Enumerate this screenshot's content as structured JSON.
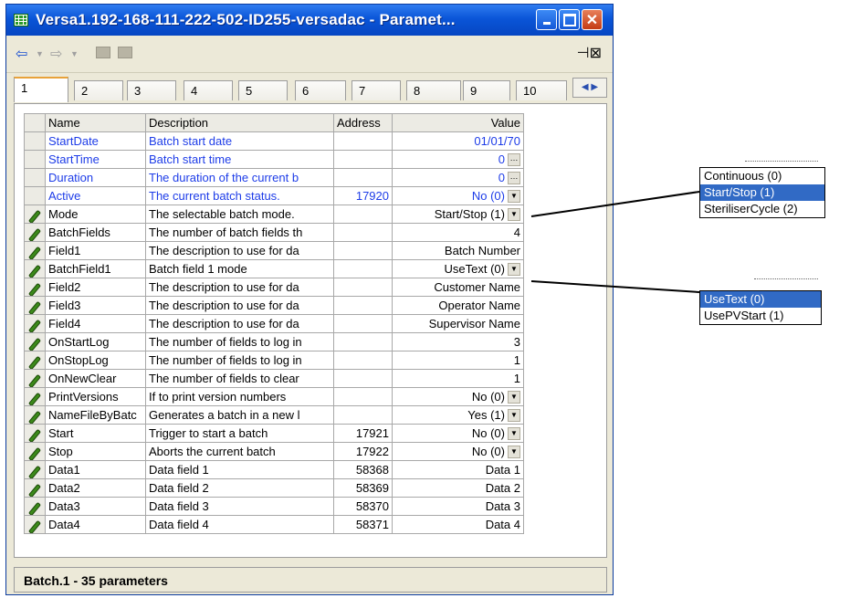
{
  "window": {
    "title": "Versa1.192-168-111-222-502-ID255-versadac - Paramet..."
  },
  "tabs": [
    "1",
    "2",
    "3",
    "4",
    "5",
    "6",
    "7",
    "8",
    "9",
    "10"
  ],
  "table": {
    "headers": {
      "name": "Name",
      "description": "Description",
      "address": "Address",
      "value": "Value"
    },
    "rows": [
      {
        "name": "StartDate",
        "description": "Batch start date",
        "address": "",
        "value": "01/01/70",
        "control": "none",
        "editable": false
      },
      {
        "name": "StartTime",
        "description": "Batch start time",
        "address": "",
        "value": "0",
        "control": "ellipsis",
        "editable": false
      },
      {
        "name": "Duration",
        "description": "The duration of the current b",
        "address": "",
        "value": "0",
        "control": "ellipsis",
        "editable": false
      },
      {
        "name": "Active",
        "description": "The current batch status.",
        "address": "17920",
        "value": "No (0)",
        "control": "dropdown",
        "editable": false
      },
      {
        "name": "Mode",
        "description": "The selectable batch mode.",
        "address": "",
        "value": "Start/Stop (1)",
        "control": "dropdown",
        "editable": true
      },
      {
        "name": "BatchFields",
        "description": "The number of batch fields th",
        "address": "",
        "value": "4",
        "control": "none",
        "editable": true
      },
      {
        "name": "Field1",
        "description": "The description to use for da",
        "address": "",
        "value": "Batch Number",
        "control": "none",
        "editable": true
      },
      {
        "name": "BatchField1",
        "description": "Batch field 1 mode",
        "address": "",
        "value": "UseText (0)",
        "control": "dropdown",
        "editable": true
      },
      {
        "name": "Field2",
        "description": "The description to use for da",
        "address": "",
        "value": "Customer Name",
        "control": "none",
        "editable": true
      },
      {
        "name": "Field3",
        "description": "The description to use for da",
        "address": "",
        "value": "Operator Name",
        "control": "none",
        "editable": true
      },
      {
        "name": "Field4",
        "description": "The description to use for da",
        "address": "",
        "value": "Supervisor Name",
        "control": "none",
        "editable": true
      },
      {
        "name": "OnStartLog",
        "description": "The number of fields to log in",
        "address": "",
        "value": "3",
        "control": "none",
        "editable": true
      },
      {
        "name": "OnStopLog",
        "description": "The number of fields to log in",
        "address": "",
        "value": "1",
        "control": "none",
        "editable": true
      },
      {
        "name": "OnNewClear",
        "description": "The number of fields to clear",
        "address": "",
        "value": "1",
        "control": "none",
        "editable": true
      },
      {
        "name": "PrintVersions",
        "description": "If to print version numbers",
        "address": "",
        "value": "No (0)",
        "control": "dropdown",
        "editable": true
      },
      {
        "name": "NameFileByBatc",
        "description": "Generates a batch in a new l",
        "address": "",
        "value": "Yes (1)",
        "control": "dropdown",
        "editable": true
      },
      {
        "name": "Start",
        "description": "Trigger to start a batch",
        "address": "17921",
        "value": "No (0)",
        "control": "dropdown",
        "editable": true
      },
      {
        "name": "Stop",
        "description": "Aborts the current batch",
        "address": "17922",
        "value": "No (0)",
        "control": "dropdown",
        "editable": true
      },
      {
        "name": "Data1",
        "description": "Data field 1",
        "address": "58368",
        "value": "Data 1",
        "control": "none",
        "editable": true
      },
      {
        "name": "Data2",
        "description": "Data field 2",
        "address": "58369",
        "value": "Data 2",
        "control": "none",
        "editable": true
      },
      {
        "name": "Data3",
        "description": "Data field 3",
        "address": "58370",
        "value": "Data 3",
        "control": "none",
        "editable": true
      },
      {
        "name": "Data4",
        "description": "Data field 4",
        "address": "58371",
        "value": "Data 4",
        "control": "none",
        "editable": true
      }
    ]
  },
  "status": {
    "text": "Batch.1  -  35 parameters"
  },
  "popups": {
    "mode_options": [
      {
        "label": "Continuous (0)",
        "selected": false
      },
      {
        "label": "Start/Stop (1)",
        "selected": true
      },
      {
        "label": "SteriliserCycle (2)",
        "selected": false
      }
    ],
    "batchfield_options": [
      {
        "label": "UseText (0)",
        "selected": true
      },
      {
        "label": "UsePVStart (1)",
        "selected": false
      }
    ]
  },
  "colors": {
    "readonly_text": "#1d3ce8",
    "selection": "#316ac5",
    "title_bar": "#0a55d8"
  }
}
